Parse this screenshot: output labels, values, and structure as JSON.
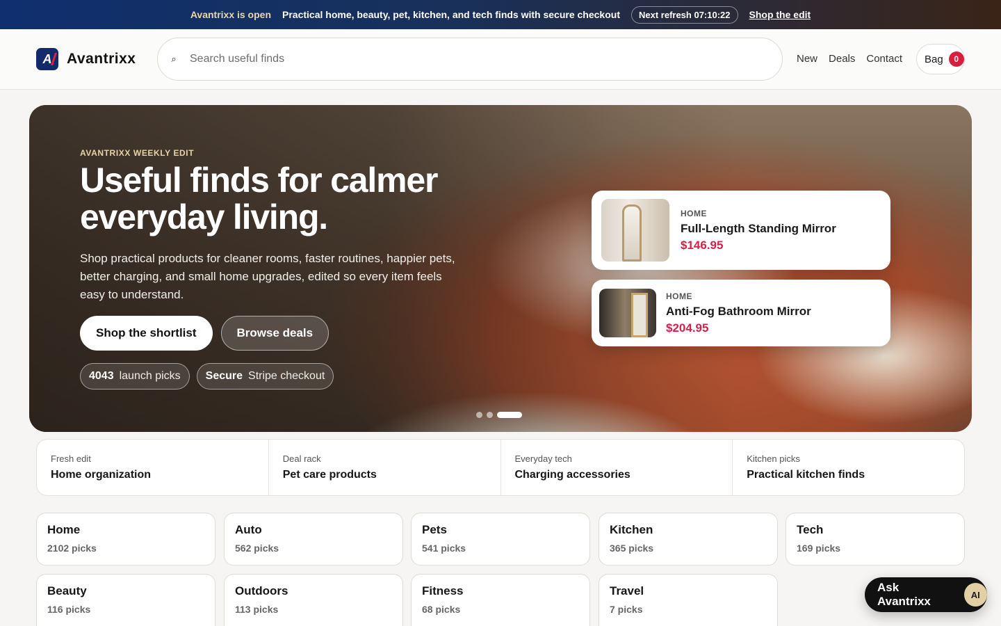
{
  "topbar": {
    "status": "Avantrixx is open",
    "message": "Practical home, beauty, pet, kitchen, and tech finds with secure checkout",
    "refresh": "Next refresh 07:10:22",
    "link": "Shop the edit"
  },
  "header": {
    "logo_mark": "A",
    "brand": "Avantrixx",
    "search_icon": "⌕",
    "search_placeholder": "Search useful finds",
    "nav": [
      "New",
      "Deals",
      "Contact"
    ],
    "bag_label": "Bag",
    "bag_count": "0"
  },
  "hero": {
    "eyebrow": "AVANTRIXX WEEKLY EDIT",
    "title": "Useful finds for calmer everyday living.",
    "body": "Shop practical products for cleaner rooms, faster routines, happier pets, better charging, and small home upgrades, edited so every item feels easy to understand.",
    "primary_cta": "Shop the shortlist",
    "secondary_cta": "Browse deals",
    "pills": [
      {
        "strong": "4043",
        "text": "launch picks"
      },
      {
        "strong": "Secure",
        "text": "Stripe checkout"
      }
    ],
    "slides": {
      "count": 3,
      "active_index": 2
    },
    "products": [
      {
        "category": "HOME",
        "name": "Full-Length Standing Mirror",
        "price": "$146.95"
      },
      {
        "category": "HOME",
        "name": "Anti-Fog Bathroom Mirror",
        "price": "$204.95"
      }
    ]
  },
  "edits": [
    {
      "kicker": "Fresh edit",
      "title": "Home organization"
    },
    {
      "kicker": "Deal rack",
      "title": "Pet care products"
    },
    {
      "kicker": "Everyday tech",
      "title": "Charging accessories"
    },
    {
      "kicker": "Kitchen picks",
      "title": "Practical kitchen finds"
    }
  ],
  "categories": [
    {
      "name": "Home",
      "count": "2102 picks"
    },
    {
      "name": "Auto",
      "count": "562 picks"
    },
    {
      "name": "Pets",
      "count": "541 picks"
    },
    {
      "name": "Kitchen",
      "count": "365 picks"
    },
    {
      "name": "Tech",
      "count": "169 picks"
    },
    {
      "name": "Beauty",
      "count": "116 picks"
    },
    {
      "name": "Outdoors",
      "count": "113 picks"
    },
    {
      "name": "Fitness",
      "count": "68 picks"
    },
    {
      "name": "Travel",
      "count": "7 picks"
    }
  ],
  "assistant": {
    "label": "Ask Avantrixx",
    "badge": "AI"
  },
  "colors": {
    "accent": "#d91e3b",
    "brand": "#132a6a",
    "price": "#d6204a"
  }
}
